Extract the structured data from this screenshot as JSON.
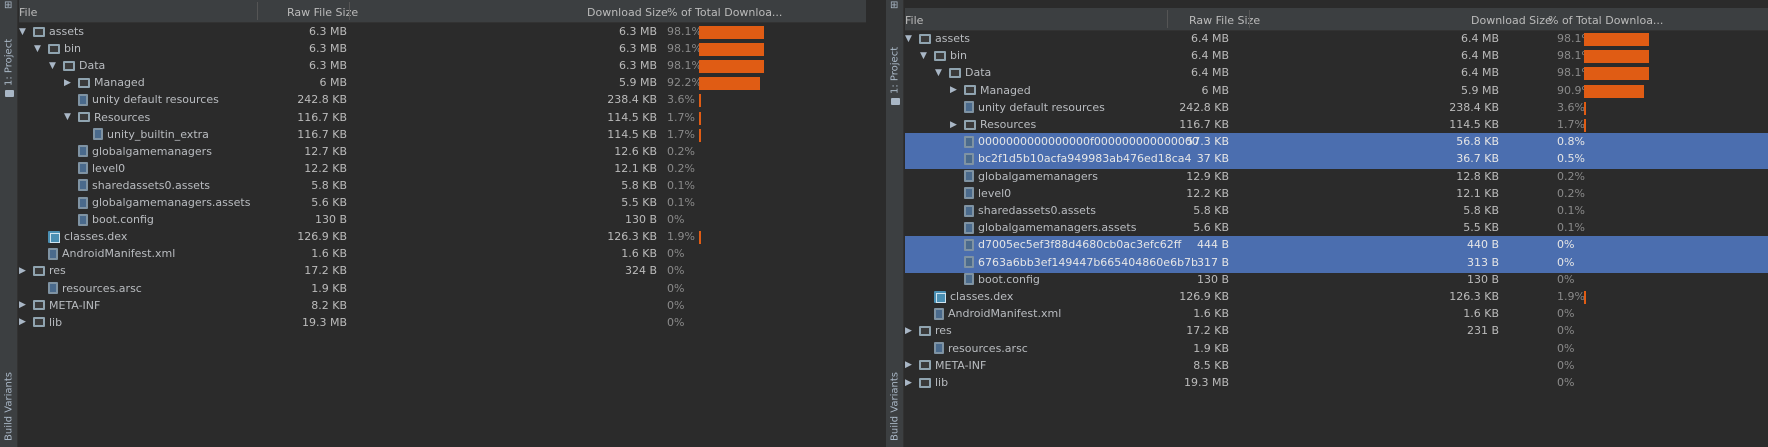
{
  "sidebar": {
    "project_label": "1: Project",
    "variants_label": "Build Variants"
  },
  "columns": {
    "file": "File",
    "raw": "Raw File Size",
    "download": "Download Size",
    "percent": "% of Total Downloa..."
  },
  "colors": {
    "bar": "#e05c14",
    "selection": "#4b6eaf"
  },
  "left": {
    "rows": [
      {
        "depth": 0,
        "arrow": "down",
        "icon": "folder-icon",
        "name": "assets",
        "raw": "6.3 MB",
        "dl": "6.3 MB",
        "pct": "98.1%",
        "pct_value": 98.1,
        "selected": false
      },
      {
        "depth": 1,
        "arrow": "down",
        "icon": "folder-icon",
        "name": "bin",
        "raw": "6.3 MB",
        "dl": "6.3 MB",
        "pct": "98.1%",
        "pct_value": 98.1,
        "selected": false
      },
      {
        "depth": 2,
        "arrow": "down",
        "icon": "folder-icon",
        "name": "Data",
        "raw": "6.3 MB",
        "dl": "6.3 MB",
        "pct": "98.1%",
        "pct_value": 98.1,
        "selected": false
      },
      {
        "depth": 3,
        "arrow": "right",
        "icon": "folder-icon",
        "name": "Managed",
        "raw": "6 MB",
        "dl": "5.9 MB",
        "pct": "92.2%",
        "pct_value": 92.2,
        "selected": false
      },
      {
        "depth": 3,
        "arrow": "",
        "icon": "file-icon",
        "name": "unity default resources",
        "raw": "242.8 KB",
        "dl": "238.4 KB",
        "pct": "3.6%",
        "pct_value": 3.6,
        "selected": false
      },
      {
        "depth": 3,
        "arrow": "down",
        "icon": "folder-icon",
        "name": "Resources",
        "raw": "116.7 KB",
        "dl": "114.5 KB",
        "pct": "1.7%",
        "pct_value": 1.7,
        "selected": false
      },
      {
        "depth": 4,
        "arrow": "",
        "icon": "file-icon",
        "name": "unity_builtin_extra",
        "raw": "116.7 KB",
        "dl": "114.5 KB",
        "pct": "1.7%",
        "pct_value": 1.7,
        "selected": false
      },
      {
        "depth": 3,
        "arrow": "",
        "icon": "file-icon",
        "name": "globalgamemanagers",
        "raw": "12.7 KB",
        "dl": "12.6 KB",
        "pct": "0.2%",
        "pct_value": 0.2,
        "selected": false
      },
      {
        "depth": 3,
        "arrow": "",
        "icon": "file-icon",
        "name": "level0",
        "raw": "12.2 KB",
        "dl": "12.1 KB",
        "pct": "0.2%",
        "pct_value": 0.2,
        "selected": false
      },
      {
        "depth": 3,
        "arrow": "",
        "icon": "file-icon",
        "name": "sharedassets0.assets",
        "raw": "5.8 KB",
        "dl": "5.8 KB",
        "pct": "0.1%",
        "pct_value": 0.1,
        "selected": false
      },
      {
        "depth": 3,
        "arrow": "",
        "icon": "file-icon",
        "name": "globalgamemanagers.assets",
        "raw": "5.6 KB",
        "dl": "5.5 KB",
        "pct": "0.1%",
        "pct_value": 0.1,
        "selected": false
      },
      {
        "depth": 3,
        "arrow": "",
        "icon": "file-icon",
        "name": "boot.config",
        "raw": "130 B",
        "dl": "130 B",
        "pct": "0%",
        "pct_value": 0,
        "selected": false
      },
      {
        "depth": 1,
        "arrow": "",
        "icon": "package-icon",
        "name": "classes.dex",
        "raw": "126.9 KB",
        "dl": "126.3 KB",
        "pct": "1.9%",
        "pct_value": 1.9,
        "selected": false
      },
      {
        "depth": 1,
        "arrow": "",
        "icon": "file-icon",
        "name": "AndroidManifest.xml",
        "raw": "1.6 KB",
        "dl": "1.6 KB",
        "pct": "0%",
        "pct_value": 0,
        "selected": false
      },
      {
        "depth": 0,
        "arrow": "right",
        "icon": "folder-icon",
        "name": "res",
        "raw": "17.2 KB",
        "dl": "324 B",
        "pct": "0%",
        "pct_value": 0,
        "selected": false
      },
      {
        "depth": 1,
        "arrow": "",
        "icon": "file-icon",
        "name": "resources.arsc",
        "raw": "1.9 KB",
        "dl": "",
        "pct": "0%",
        "pct_value": 0,
        "selected": false
      },
      {
        "depth": 0,
        "arrow": "right",
        "icon": "folder-icon",
        "name": "META-INF",
        "raw": "8.2 KB",
        "dl": "",
        "pct": "0%",
        "pct_value": 0,
        "selected": false
      },
      {
        "depth": 0,
        "arrow": "right",
        "icon": "folder-icon",
        "name": "lib",
        "raw": "19.3 MB",
        "dl": "",
        "pct": "0%",
        "pct_value": 0,
        "selected": false
      }
    ]
  },
  "right": {
    "rows": [
      {
        "depth": 0,
        "arrow": "down",
        "icon": "folder-icon",
        "name": "assets",
        "raw": "6.4 MB",
        "dl": "6.4 MB",
        "pct": "98.1%",
        "pct_value": 98.1,
        "selected": false
      },
      {
        "depth": 1,
        "arrow": "down",
        "icon": "folder-icon",
        "name": "bin",
        "raw": "6.4 MB",
        "dl": "6.4 MB",
        "pct": "98.1%",
        "pct_value": 98.1,
        "selected": false
      },
      {
        "depth": 2,
        "arrow": "down",
        "icon": "folder-icon",
        "name": "Data",
        "raw": "6.4 MB",
        "dl": "6.4 MB",
        "pct": "98.1%",
        "pct_value": 98.1,
        "selected": false
      },
      {
        "depth": 3,
        "arrow": "right",
        "icon": "folder-icon",
        "name": "Managed",
        "raw": "6 MB",
        "dl": "5.9 MB",
        "pct": "90.9%",
        "pct_value": 90.9,
        "selected": false
      },
      {
        "depth": 3,
        "arrow": "",
        "icon": "file-icon",
        "name": "unity default resources",
        "raw": "242.8 KB",
        "dl": "238.4 KB",
        "pct": "3.6%",
        "pct_value": 3.6,
        "selected": false
      },
      {
        "depth": 3,
        "arrow": "right",
        "icon": "folder-icon",
        "name": "Resources",
        "raw": "116.7 KB",
        "dl": "114.5 KB",
        "pct": "1.7%",
        "pct_value": 1.7,
        "selected": false
      },
      {
        "depth": 3,
        "arrow": "",
        "icon": "file-icon",
        "name": "0000000000000000f000000000000000",
        "raw": "57.3 KB",
        "dl": "56.8 KB",
        "pct": "0.8%",
        "pct_value": 0.8,
        "selected": true
      },
      {
        "depth": 3,
        "arrow": "",
        "icon": "file-icon",
        "name": "bc2f1d5b10acfa949983ab476ed18ca4",
        "raw": "37 KB",
        "dl": "36.7 KB",
        "pct": "0.5%",
        "pct_value": 0.5,
        "selected": true
      },
      {
        "depth": 3,
        "arrow": "",
        "icon": "file-icon",
        "name": "globalgamemanagers",
        "raw": "12.9 KB",
        "dl": "12.8 KB",
        "pct": "0.2%",
        "pct_value": 0.2,
        "selected": false
      },
      {
        "depth": 3,
        "arrow": "",
        "icon": "file-icon",
        "name": "level0",
        "raw": "12.2 KB",
        "dl": "12.1 KB",
        "pct": "0.2%",
        "pct_value": 0.2,
        "selected": false
      },
      {
        "depth": 3,
        "arrow": "",
        "icon": "file-icon",
        "name": "sharedassets0.assets",
        "raw": "5.8 KB",
        "dl": "5.8 KB",
        "pct": "0.1%",
        "pct_value": 0.1,
        "selected": false
      },
      {
        "depth": 3,
        "arrow": "",
        "icon": "file-icon",
        "name": "globalgamemanagers.assets",
        "raw": "5.6 KB",
        "dl": "5.5 KB",
        "pct": "0.1%",
        "pct_value": 0.1,
        "selected": false
      },
      {
        "depth": 3,
        "arrow": "",
        "icon": "file-icon",
        "name": "d7005ec5ef3f88d4680cb0ac3efc62ff",
        "raw": "444 B",
        "dl": "440 B",
        "pct": "0%",
        "pct_value": 0,
        "selected": true
      },
      {
        "depth": 3,
        "arrow": "",
        "icon": "file-icon",
        "name": "6763a6bb3ef149447b665404860e6b7b",
        "raw": "317 B",
        "dl": "313 B",
        "pct": "0%",
        "pct_value": 0,
        "selected": true
      },
      {
        "depth": 3,
        "arrow": "",
        "icon": "file-icon",
        "name": "boot.config",
        "raw": "130 B",
        "dl": "130 B",
        "pct": "0%",
        "pct_value": 0,
        "selected": false
      },
      {
        "depth": 1,
        "arrow": "",
        "icon": "package-icon",
        "name": "classes.dex",
        "raw": "126.9 KB",
        "dl": "126.3 KB",
        "pct": "1.9%",
        "pct_value": 1.9,
        "selected": false
      },
      {
        "depth": 1,
        "arrow": "",
        "icon": "file-icon",
        "name": "AndroidManifest.xml",
        "raw": "1.6 KB",
        "dl": "1.6 KB",
        "pct": "0%",
        "pct_value": 0,
        "selected": false
      },
      {
        "depth": 0,
        "arrow": "right",
        "icon": "folder-icon",
        "name": "res",
        "raw": "17.2 KB",
        "dl": "231 B",
        "pct": "0%",
        "pct_value": 0,
        "selected": false
      },
      {
        "depth": 1,
        "arrow": "",
        "icon": "file-icon",
        "name": "resources.arsc",
        "raw": "1.9 KB",
        "dl": "",
        "pct": "0%",
        "pct_value": 0,
        "selected": false
      },
      {
        "depth": 0,
        "arrow": "right",
        "icon": "folder-icon",
        "name": "META-INF",
        "raw": "8.5 KB",
        "dl": "",
        "pct": "0%",
        "pct_value": 0,
        "selected": false
      },
      {
        "depth": 0,
        "arrow": "right",
        "icon": "folder-icon",
        "name": "lib",
        "raw": "19.3 MB",
        "dl": "",
        "pct": "0%",
        "pct_value": 0,
        "selected": false
      }
    ]
  }
}
